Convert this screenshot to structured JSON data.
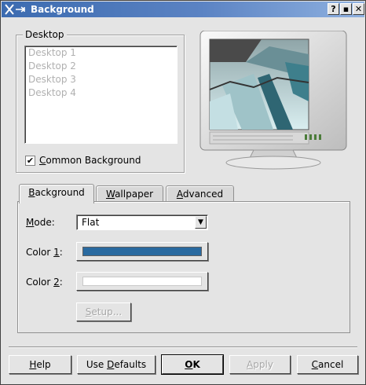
{
  "window": {
    "title": "Background",
    "system_icon": "X",
    "controls": {
      "help": "?",
      "maximize": "▪",
      "close": "✕"
    }
  },
  "desktop_group": {
    "title": "Desktop",
    "desktops": [
      "Desktop 1",
      "Desktop 2",
      "Desktop 3",
      "Desktop 4"
    ],
    "common_background": {
      "label_accel": "C",
      "label_rest": "ommon Background",
      "checked": true
    }
  },
  "tabs": [
    {
      "accel": "B",
      "rest": "ackground",
      "active": true
    },
    {
      "accel": "W",
      "rest": "allpaper",
      "active": false
    },
    {
      "accel": "A",
      "rest": "dvanced",
      "active": false
    }
  ],
  "background_tab": {
    "mode": {
      "label_accel": "M",
      "label_rest": "ode:",
      "value": "Flat"
    },
    "color1": {
      "label_pre": "Color ",
      "label_accel": "1",
      "label_post": ":",
      "color": "#2a6aa0"
    },
    "color2": {
      "label_pre": "Color ",
      "label_accel": "2",
      "label_post": ":",
      "color": "#ffffff",
      "enabled": false
    },
    "setup": {
      "label_accel": "S",
      "label_rest": "etup...",
      "enabled": false
    }
  },
  "buttons": {
    "help": {
      "accel": "H",
      "rest": "elp"
    },
    "defaults": {
      "pre": "Use ",
      "accel": "D",
      "rest": "efaults"
    },
    "ok": {
      "accel": "O",
      "rest": "K"
    },
    "apply": {
      "accel": "A",
      "rest": "pply"
    },
    "cancel": {
      "accel": "C",
      "rest": "ancel"
    }
  }
}
